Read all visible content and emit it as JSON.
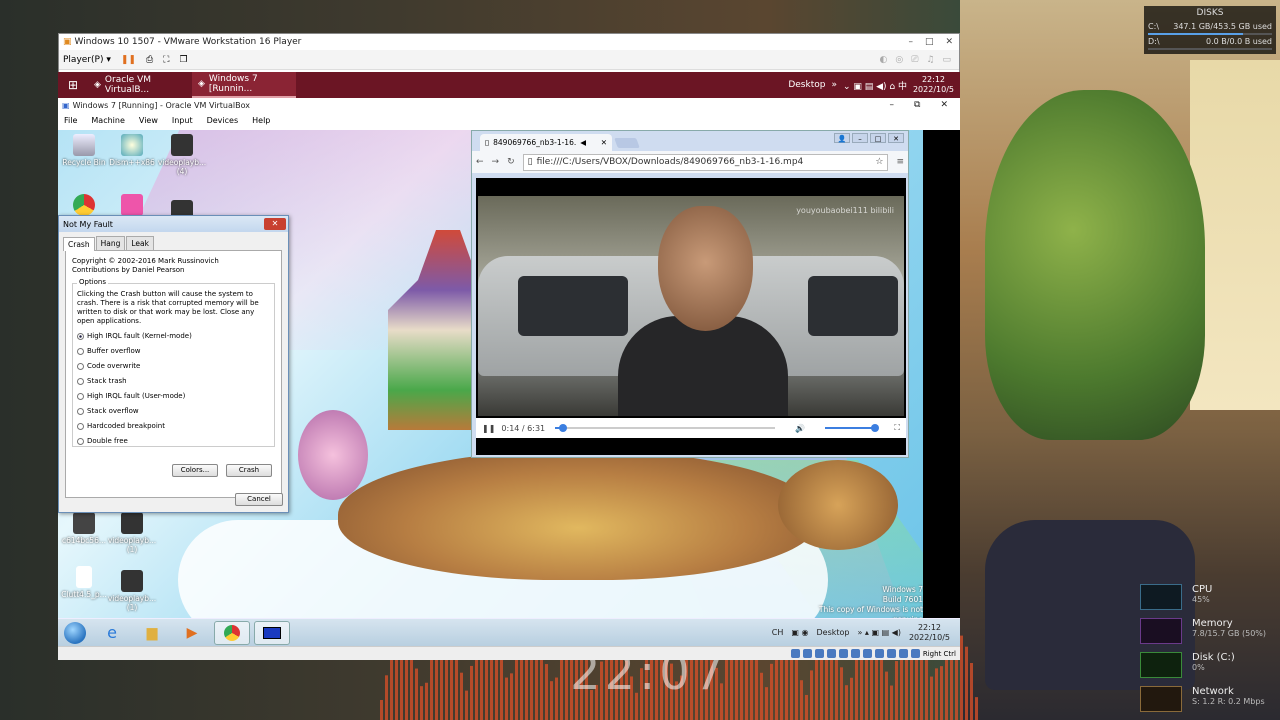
{
  "host": {
    "disks": {
      "title": "DISKS",
      "rows": [
        {
          "drive": "C:\\",
          "value": "347.1 GB/453.5 GB used",
          "fill": 0.77
        },
        {
          "drive": "D:\\",
          "value": "0.0 B/0.0 B used",
          "fill": 0.0
        }
      ]
    },
    "perf": [
      {
        "name": "CPU",
        "sub": "45%",
        "color": "#59a0e8"
      },
      {
        "name": "Memory",
        "sub": "7.8/15.7 GB (50%)",
        "color": "#a259e8"
      },
      {
        "name": "Disk (C:)",
        "sub": "0%",
        "color": "#59c060"
      },
      {
        "name": "Network",
        "sub": "S: 1.2  R: 0.2 Mbps",
        "color": "#e8a059"
      }
    ]
  },
  "vmware": {
    "title": "Windows 10 1507 - VMware Workstation 16 Player",
    "menu": "Player(P)",
    "win_controls": [
      "–",
      "□",
      "✕"
    ]
  },
  "win10": {
    "tasks": [
      {
        "label": "Oracle VM VirtualB...",
        "active": false
      },
      {
        "label": "Windows 7 [Runnin...",
        "active": true
      }
    ],
    "tray": {
      "desktop": "Desktop",
      "time": "22:12",
      "date": "2022/10/5"
    }
  },
  "virtualbox": {
    "title": "Windows 7 [Running] - Oracle VM VirtualBox",
    "menu": [
      "File",
      "Machine",
      "View",
      "Input",
      "Devices",
      "Help"
    ],
    "status_right": "Right Ctrl"
  },
  "win7": {
    "desktop_icons": [
      {
        "label": "Recycle Bin"
      },
      {
        "label": "Dism++x86"
      },
      {
        "label": "videoplayb...\n(4)"
      },
      {
        "label": "c614bc56..."
      },
      {
        "label": "videoplayb...\n(1)"
      },
      {
        "label": "Clutt4.5_p..."
      },
      {
        "label": "videoplayb...\n(1)"
      }
    ],
    "watermark": [
      "Windows 7",
      "Build 7601",
      "This copy of Windows is not genuine"
    ],
    "tray": {
      "lang": "CH",
      "desktop": "Desktop",
      "time": "22:12",
      "date": "2022/10/5"
    }
  },
  "notmyfault": {
    "title": "Not My Fault",
    "tabs": [
      "Crash",
      "Hang",
      "Leak"
    ],
    "copyright": "Copyright © 2002-2016 Mark Russinovich",
    "contrib": "Contributions by Daniel Pearson",
    "options_label": "Options",
    "warning": "Clicking the Crash button will cause the system to crash. There is a risk that corrupted memory will be written to disk or that work may be lost. Close any open applications.",
    "options": [
      "High IRQL fault (Kernel-mode)",
      "Buffer overflow",
      "Code overwrite",
      "Stack trash",
      "High IRQL fault (User-mode)",
      "Stack overflow",
      "Hardcoded breakpoint",
      "Double free"
    ],
    "selected": 0,
    "colors_btn": "Colors...",
    "crash_btn": "Crash",
    "cancel_btn": "Cancel"
  },
  "chrome": {
    "tab_title": "849069766_nb3-1-16.",
    "url": "file:///C:/Users/VBOX/Downloads/849069766_nb3-1-16.mp4",
    "video": {
      "watermark": "youyoubaobei111  bilibili",
      "time": "0:14 / 6:31",
      "progress": 0.036,
      "volume": 1.0
    }
  }
}
